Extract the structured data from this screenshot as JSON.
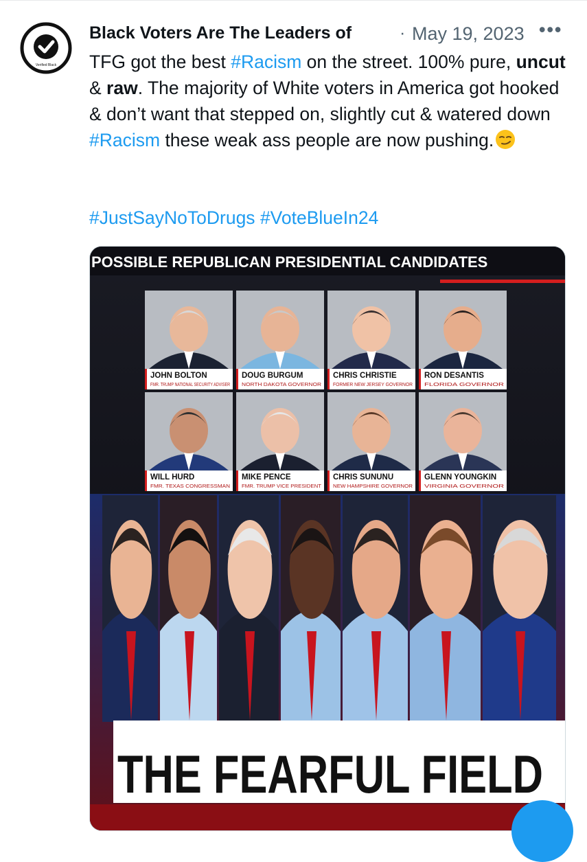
{
  "tweet": {
    "author": "Black Voters Are The Leaders of",
    "separator": "·",
    "date": "May 19, 2023",
    "more_icon": "more-horizontal-icon",
    "avatar_badge_text": "Verified Black",
    "text": {
      "s1": "TFG got the best ",
      "tag1": "#Racism",
      "s2": " on the street. 100% pure, ",
      "b1": "uncut",
      "s3": " & ",
      "b2": "raw",
      "s4": ". The majority of White voters in America got hooked & don’t want that stepped on, slightly cut & watered down ",
      "tag2": "#Racism",
      "s5": " these weak ass people are now pushing.",
      "emoji": "smirking-face-emoji"
    },
    "hashtags": [
      "#JustSayNoToDrugs",
      "#VoteBlueIn24"
    ]
  },
  "media": {
    "banner": "POSSIBLE REPUBLICAN PRESIDENTIAL CANDIDATES",
    "candidates": [
      {
        "name": "JOHN BOLTON",
        "title": "FMR. TRUMP NATIONAL SECURITY ADVISER"
      },
      {
        "name": "DOUG BURGUM",
        "title": "NORTH DAKOTA GOVERNOR"
      },
      {
        "name": "CHRIS CHRISTIE",
        "title": "FORMER NEW JERSEY GOVERNOR"
      },
      {
        "name": "RON DESANTIS",
        "title": "FLORIDA GOVERNOR"
      },
      {
        "name": "WILL HURD",
        "title": "FMR. TEXAS CONGRESSMAN"
      },
      {
        "name": "MIKE PENCE",
        "title": "FMR. TRUMP VICE PRESIDENT"
      },
      {
        "name": "CHRIS SUNUNU",
        "title": "NEW HAMPSHIRE GOVERNOR"
      },
      {
        "name": "GLENN YOUNGKIN",
        "title": "VIRGINIA GOVERNOR"
      }
    ],
    "lower_caption": "THE FEARFUL FIELD",
    "colors": {
      "accent_red": "#d41e1e",
      "link_blue": "#1d9bf0"
    }
  }
}
